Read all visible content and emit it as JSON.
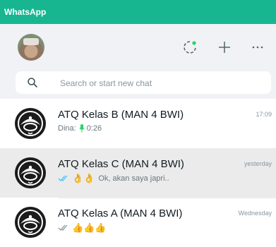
{
  "window": {
    "title": "WhatsApp"
  },
  "header": {
    "icons": [
      "status-icon",
      "new-chat-plus-icon",
      "menu-dots-icon"
    ],
    "status_dot_color": "#25d366"
  },
  "search": {
    "placeholder": "Search or start new chat"
  },
  "chats": [
    {
      "name": "ATQ Kelas B (MAN 4 BWI)",
      "time": "17:09",
      "sender": "Dina:",
      "icon": "microphone-icon",
      "preview": "0:26",
      "selected": false
    },
    {
      "name": "ATQ Kelas C (MAN 4 BWI)",
      "time": "yesterday",
      "ticks": "read-ticks-blue",
      "emojis": "👌👌",
      "preview": "Ok, akan saya japri..",
      "selected": true
    },
    {
      "name": "ATQ Kelas A (MAN 4 BWI)",
      "time": "Wednesday",
      "ticks": "delivered-ticks-gray",
      "emojis": "👍👍👍",
      "preview": "",
      "selected": false
    }
  ],
  "colors": {
    "titlebar": "#17b691",
    "header_bg": "#f0f2f5",
    "read_tick": "#53bdeb",
    "mic": "#25d366"
  }
}
